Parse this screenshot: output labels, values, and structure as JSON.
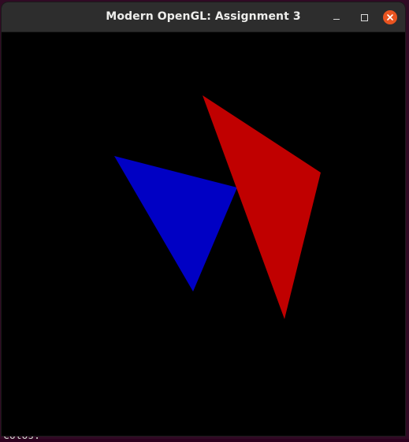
{
  "window": {
    "title": "Modern OpenGL: Assignment 3"
  },
  "controls": {
    "minimize_icon": "minimize-icon",
    "maximize_icon": "maximize-icon",
    "close_icon": "close-icon",
    "close_color": "#e95420"
  },
  "scene": {
    "background_color": "#000000",
    "triangles": [
      {
        "name": "blue-triangle",
        "color": "#0000c4"
      },
      {
        "name": "red-triangle",
        "color": "#c00000"
      }
    ]
  },
  "terminal_behind": {
    "visible_text": "Colos:"
  }
}
